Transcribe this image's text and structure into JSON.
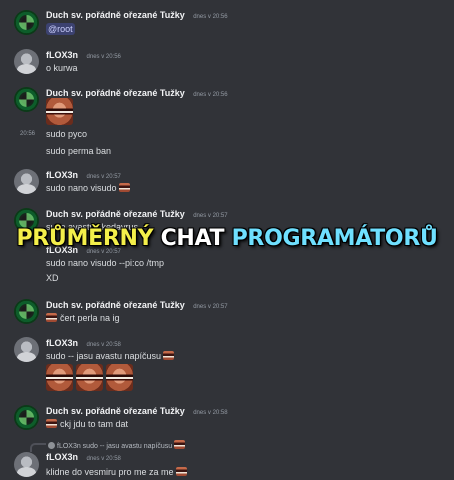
{
  "users": {
    "duch": "Duch sv. pořádně ořezané Tužky",
    "flox": "fLOX3n"
  },
  "messages": {
    "m1": {
      "time": "dnes v 20:56",
      "text": "@root"
    },
    "m2": {
      "time": "dnes v 20:56",
      "text": "o kurwa"
    },
    "m3": {
      "time": "dnes v 20:56",
      "side_time": "20:56",
      "line1": "sudo pyco",
      "line2": "sudo perma ban"
    },
    "m4": {
      "time": "dnes v 20:57",
      "text": "sudo nano visudo"
    },
    "m5": {
      "time": "dnes v 20:57",
      "text": "sudo avastus kedavrus"
    },
    "m6": {
      "author": "fLOX3n",
      "time": "dnes v 20:57",
      "line1": "sudo nano visudo --pi:co /tmp",
      "line2": "XD"
    },
    "m7": {
      "time": "dnes v 20:57",
      "text": "čert perla na ig"
    },
    "m8": {
      "time": "dnes v 20:58",
      "text": "sudo -- jasu avastu napíčusu"
    },
    "m9": {
      "time": "dnes v 20:58",
      "text": "ckj jdu to tam dat"
    },
    "m10": {
      "reply": "fLOX3n sudo -- jasu avastu napíčusu",
      "time": "dnes v 20:58",
      "text": "klidne do vesmiru pro me za me"
    }
  },
  "overlay": {
    "part_a": "PRŮMĚRNÝ",
    "part_b": "CHAT",
    "part_c": "PROGRAMÁTORŮ"
  },
  "emojis": {
    "small": "grimace-emoji",
    "large": "grimace-sticker"
  }
}
